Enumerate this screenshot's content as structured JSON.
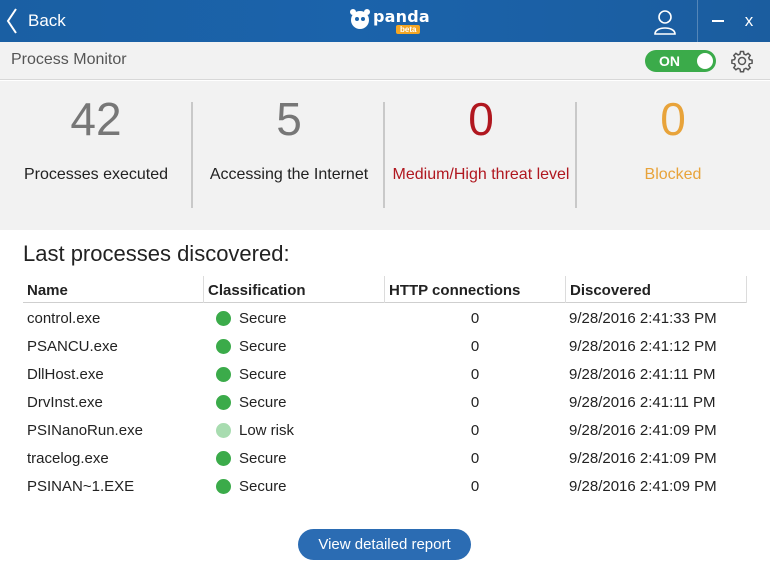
{
  "titlebar": {
    "back_label": "Back",
    "logo_text": "panda",
    "logo_badge": "beta",
    "close_glyph": "x"
  },
  "header": {
    "title": "Process Monitor",
    "toggle_label": "ON"
  },
  "stats": [
    {
      "value": "42",
      "label": "Processes executed",
      "color": "#777777",
      "label_color": "#222222"
    },
    {
      "value": "5",
      "label": "Accessing the Internet",
      "color": "#777777",
      "label_color": "#222222"
    },
    {
      "value": "0",
      "label": "Medium/High threat level",
      "color": "#b0171f",
      "label_color": "#b0171f"
    },
    {
      "value": "0",
      "label": "Blocked",
      "color": "#e8a33a",
      "label_color": "#e8a33a"
    }
  ],
  "processes": {
    "title": "Last processes discovered:",
    "columns": [
      "Name",
      "Classification",
      "HTTP connections",
      "Discovered"
    ],
    "rows": [
      {
        "name": "control.exe",
        "classification": "Secure",
        "status_color": "#3bab4a",
        "http": "0",
        "discovered": "9/28/2016 2:41:33 PM"
      },
      {
        "name": "PSANCU.exe",
        "classification": "Secure",
        "status_color": "#3bab4a",
        "http": "0",
        "discovered": "9/28/2016 2:41:12 PM"
      },
      {
        "name": "DllHost.exe",
        "classification": "Secure",
        "status_color": "#3bab4a",
        "http": "0",
        "discovered": "9/28/2016 2:41:11 PM"
      },
      {
        "name": "DrvInst.exe",
        "classification": "Secure",
        "status_color": "#3bab4a",
        "http": "0",
        "discovered": "9/28/2016 2:41:11 PM"
      },
      {
        "name": "PSINanoRun.exe",
        "classification": "Low risk",
        "status_color": "#a8dcb0",
        "http": "0",
        "discovered": "9/28/2016 2:41:09 PM"
      },
      {
        "name": "tracelog.exe",
        "classification": "Secure",
        "status_color": "#3bab4a",
        "http": "0",
        "discovered": "9/28/2016 2:41:09 PM"
      },
      {
        "name": "PSINAN~1.EXE",
        "classification": "Secure",
        "status_color": "#3bab4a",
        "http": "0",
        "discovered": "9/28/2016 2:41:09 PM"
      }
    ]
  },
  "footer": {
    "report_button": "View detailed report"
  }
}
